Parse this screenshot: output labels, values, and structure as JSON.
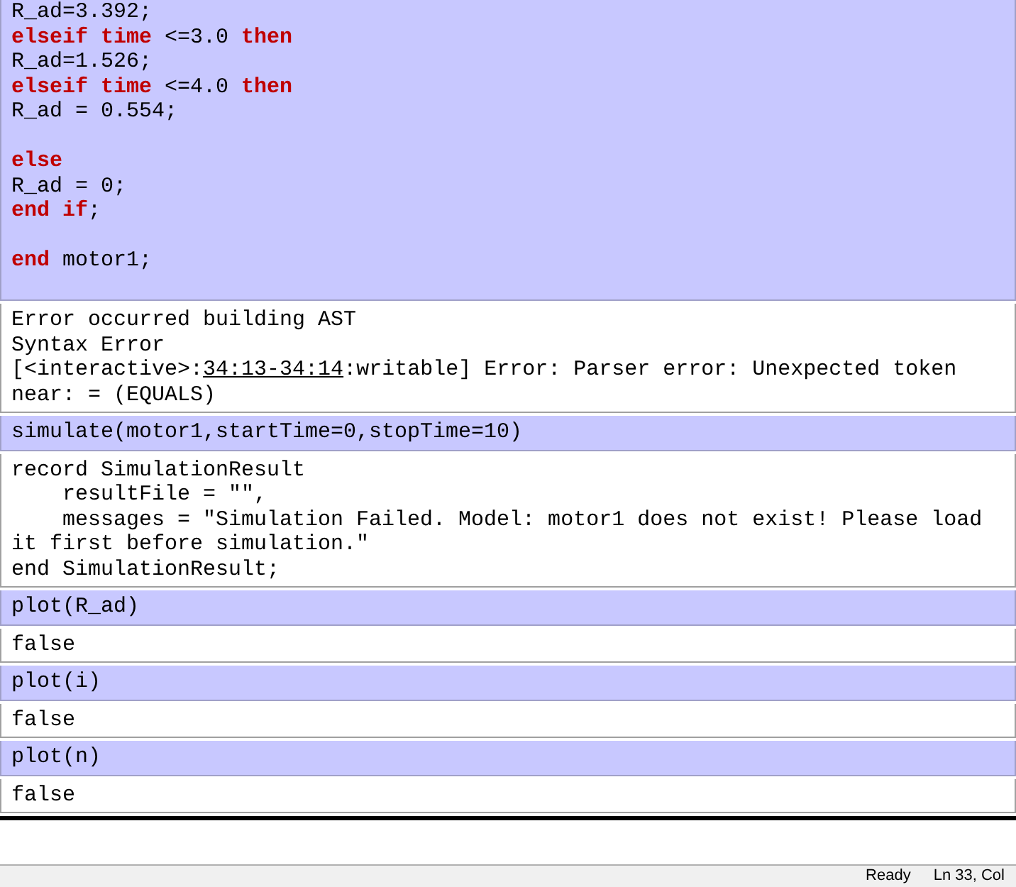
{
  "cells": [
    {
      "kind": "input",
      "lines": [
        [
          {
            "kind": "text",
            "text": "R_ad=3.392;"
          }
        ],
        [
          {
            "kind": "keyword",
            "text": "elseif"
          },
          {
            "kind": "keyword",
            "text": " time"
          },
          {
            "kind": "text",
            "text": " <=3.0 "
          },
          {
            "kind": "keyword",
            "text": "then"
          }
        ],
        [
          {
            "kind": "text",
            "text": "R_ad=1.526;"
          }
        ],
        [
          {
            "kind": "keyword",
            "text": "elseif"
          },
          {
            "kind": "keyword",
            "text": " time"
          },
          {
            "kind": "text",
            "text": " <=4.0 "
          },
          {
            "kind": "keyword",
            "text": "then"
          }
        ],
        [
          {
            "kind": "text",
            "text": "R_ad = 0.554;"
          }
        ],
        [
          {
            "kind": "blank"
          }
        ],
        [
          {
            "kind": "keyword",
            "text": "else"
          }
        ],
        [
          {
            "kind": "text",
            "text": "R_ad = 0;"
          }
        ],
        [
          {
            "kind": "keyword",
            "text": "end"
          },
          {
            "kind": "keyword",
            "text": " if"
          },
          {
            "kind": "text",
            "text": ";"
          }
        ],
        [
          {
            "kind": "blank"
          }
        ],
        [
          {
            "kind": "keyword",
            "text": "end"
          },
          {
            "kind": "text",
            "text": " motor1;"
          }
        ],
        [
          {
            "kind": "blank"
          }
        ]
      ]
    },
    {
      "kind": "output",
      "lines": [
        [
          {
            "kind": "text",
            "text": "Error occurred building AST"
          }
        ],
        [
          {
            "kind": "text",
            "text": "Syntax Error"
          }
        ],
        [
          {
            "kind": "text",
            "text": "[<interactive>:"
          },
          {
            "kind": "link",
            "text": "34:13-34:14"
          },
          {
            "kind": "text",
            "text": ":writable] Error: Parser error: Unexpected token"
          }
        ],
        [
          {
            "kind": "text",
            "text": "near: = (EQUALS)"
          }
        ]
      ]
    },
    {
      "kind": "input",
      "lines": [
        [
          {
            "kind": "text",
            "text": "simulate(motor1,startTime=0,stopTime=10)"
          }
        ]
      ]
    },
    {
      "kind": "output",
      "lines": [
        [
          {
            "kind": "text",
            "text": "record SimulationResult"
          }
        ],
        [
          {
            "kind": "text",
            "text": "    resultFile = \"\","
          }
        ],
        [
          {
            "kind": "text",
            "text": "    messages = \"Simulation Failed. Model: motor1 does not exist! Please load"
          }
        ],
        [
          {
            "kind": "text",
            "text": "it first before simulation.\""
          }
        ],
        [
          {
            "kind": "text",
            "text": "end SimulationResult;"
          }
        ]
      ]
    },
    {
      "kind": "input",
      "lines": [
        [
          {
            "kind": "text",
            "text": "plot(R_ad)"
          }
        ]
      ]
    },
    {
      "kind": "output",
      "lines": [
        [
          {
            "kind": "text",
            "text": "false"
          }
        ]
      ]
    },
    {
      "kind": "input",
      "lines": [
        [
          {
            "kind": "text",
            "text": "plot(i)"
          }
        ]
      ]
    },
    {
      "kind": "output",
      "lines": [
        [
          {
            "kind": "text",
            "text": "false"
          }
        ]
      ]
    },
    {
      "kind": "input",
      "lines": [
        [
          {
            "kind": "text",
            "text": "plot(n)"
          }
        ]
      ]
    },
    {
      "kind": "output",
      "lines": [
        [
          {
            "kind": "text",
            "text": "false"
          }
        ]
      ]
    }
  ],
  "status_bar": [
    "Ready",
    "Ln 33, Col"
  ]
}
